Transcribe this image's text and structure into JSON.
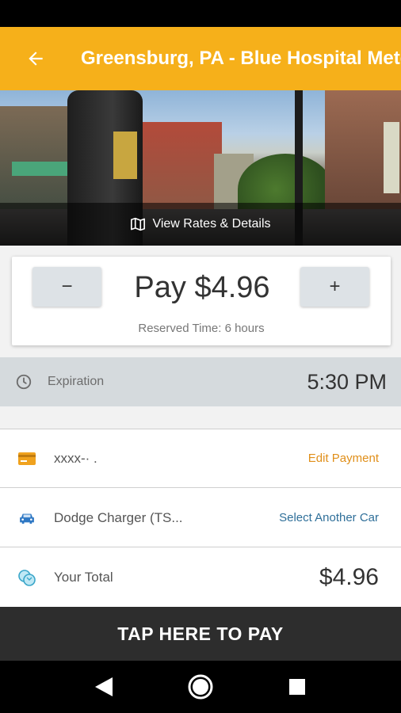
{
  "app_bar": {
    "title": "Greensburg, PA - Blue Hospital Meters",
    "back_icon": "arrow-left-icon",
    "color": "#f6b01a"
  },
  "hero": {
    "rates_label": "View Rates & Details",
    "rates_icon": "map-icon"
  },
  "pay_card": {
    "minus_label": "−",
    "plus_label": "+",
    "pay_label": "Pay $4.96",
    "reserved_label": "Reserved Time: 6 hours"
  },
  "expiration": {
    "icon": "clock-icon",
    "label": "Expiration",
    "time": "5:30 PM"
  },
  "payment": {
    "icon": "credit-card-icon",
    "card_text": "xxxx-·   .",
    "action": "Edit Payment",
    "action_color": "#e08f1a"
  },
  "vehicle": {
    "icon": "car-icon",
    "name": "Dodge Charger (TS...",
    "action": "Select Another Car",
    "action_color": "#2f6f99"
  },
  "total": {
    "icon": "coins-icon",
    "label": "Your Total",
    "amount": "$4.96"
  },
  "pay_button": {
    "label": "TAP HERE TO PAY"
  },
  "nav": {
    "back_icon": "nav-back-icon",
    "home_icon": "nav-home-icon",
    "recents_icon": "nav-recents-icon"
  }
}
